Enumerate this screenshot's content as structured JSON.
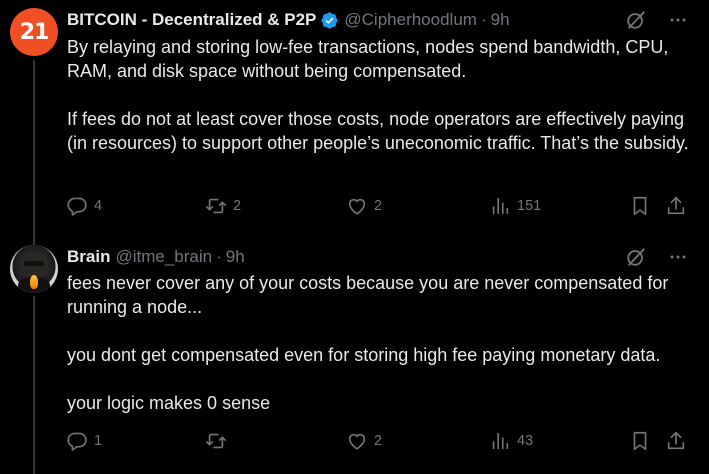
{
  "posts": [
    {
      "author_name": "BITCOIN - Decentralized & P2P",
      "avatar_text": "21",
      "verified": true,
      "handle": "@Cipherhoodlum",
      "separator": "·",
      "time": "9h",
      "paragraphs": [
        "By relaying and storing low-fee transactions, nodes spend bandwidth, CPU, RAM, and disk space without being compensated.",
        "If fees do not at least cover those costs, node operators are effectively paying (in resources) to support other people’s uneconomic traffic. That’s the subsidy."
      ],
      "stats": {
        "replies": "4",
        "reposts": "2",
        "likes": "2",
        "views": "151"
      }
    },
    {
      "author_name": "Brain",
      "verified": false,
      "handle": "@itme_brain",
      "separator": "·",
      "time": "9h",
      "paragraphs": [
        "fees never cover any of your costs because you are never compensated for running a node...",
        "you dont get compensated even for storing high fee paying monetary data.",
        "your logic makes 0 sense"
      ],
      "stats": {
        "replies": "1",
        "reposts": "",
        "likes": "2",
        "views": "43"
      }
    }
  ],
  "colors": {
    "background": "#000000",
    "text": "#e7e9ea",
    "muted": "#71767b",
    "verified_blue": "#1d9bf0",
    "avatar_orange": "#f04e23",
    "thread_line": "#333639"
  },
  "icons": [
    "reply-icon",
    "repost-icon",
    "like-icon",
    "views-icon",
    "bookmark-icon",
    "share-icon",
    "grok-icon",
    "more-icon",
    "verified-badge-icon"
  ]
}
